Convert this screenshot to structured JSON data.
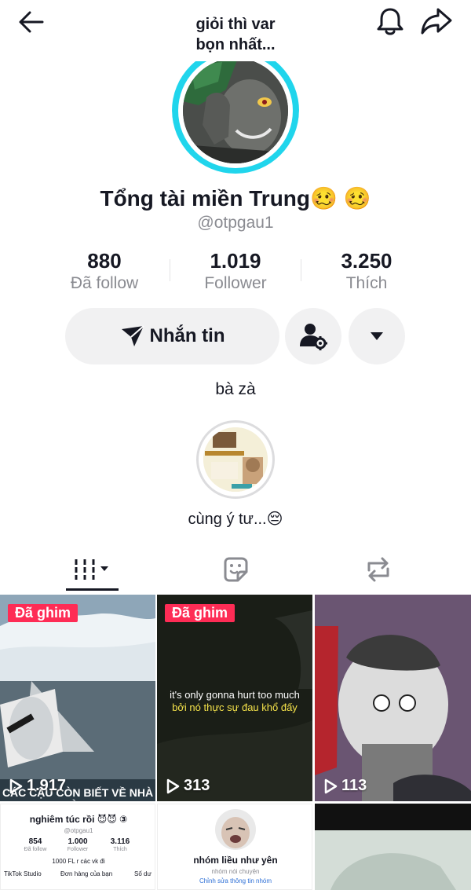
{
  "header": {
    "title_line1": "giỏi thì var",
    "title_line2": "bọn nhất..."
  },
  "profile": {
    "display_name": "Tổng tài miền Trung🥴 🥴",
    "username": "@otpgau1",
    "bio": "bà zà"
  },
  "stats": [
    {
      "value": "880",
      "label": "Đã follow"
    },
    {
      "value": "1.019",
      "label": "Follower"
    },
    {
      "value": "3.250",
      "label": "Thích"
    }
  ],
  "actions": {
    "message_label": "Nhắn tin"
  },
  "highlight": {
    "label": "cùng ý tư...😔"
  },
  "videos": [
    {
      "pinned_label": "Đã ghim",
      "views": "1.917",
      "caption": "CÁC CẬU CÒN BIẾT VỀ NHÀ À?"
    },
    {
      "pinned_label": "Đã ghim",
      "views": "313",
      "caption_en": "it's only gonna hurt too much",
      "caption_vi": "bởi nó thực sự đau khổ đấy"
    },
    {
      "views": "113"
    },
    {
      "profile_name": "nghiêm túc rồi 😈😈 ③",
      "profile_handle": "@otpgau1",
      "stat1": "854",
      "stat1_label": "Đã follow",
      "stat2": "1.000",
      "stat2_label": "Follower",
      "stat3": "3.116",
      "stat3_label": "Thích",
      "bio": "1000 FL r các vk đi",
      "link1": "TikTok Studio",
      "link2": "Đơn hàng của bạn",
      "link3": "Số dư"
    },
    {
      "group_name": "nhóm liều như yên",
      "group_sub": "nhóm nói chuyện",
      "group_link": "Chỉnh sửa thông tin nhóm"
    },
    {}
  ],
  "colors": {
    "accent": "#fe2c55",
    "ring": "#20d5ec",
    "text": "#161823",
    "muted": "#8a8b91",
    "button_bg": "#f1f1f2"
  },
  "icons": [
    "back-arrow-icon",
    "bell-icon",
    "share-icon",
    "send-icon",
    "add-friend-icon",
    "chevron-down-icon",
    "videos-grid-icon",
    "sticker-icon",
    "repost-icon",
    "play-icon"
  ]
}
